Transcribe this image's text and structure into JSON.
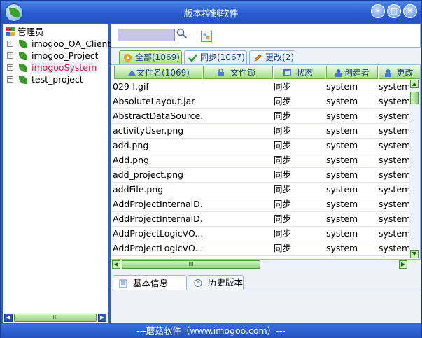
{
  "window": {
    "title": "版本控制软件",
    "footer": "---蘑菇软件（www.imogoo.com）---"
  },
  "tree": {
    "root": "管理员",
    "items": [
      {
        "label": "imogoo_OA_Client",
        "selected": false
      },
      {
        "label": "imogoo_Project",
        "selected": false
      },
      {
        "label": "imogooSystem",
        "selected": true
      },
      {
        "label": "test_project",
        "selected": false
      }
    ]
  },
  "search": {
    "value": "",
    "placeholder": ""
  },
  "tabs": [
    {
      "label": "全部(1069)",
      "icon": "asterisk-icon"
    },
    {
      "label": "同步(1067)",
      "icon": "checkmark-icon"
    },
    {
      "label": "更改(2)",
      "icon": "pencil-icon"
    }
  ],
  "columns": [
    "文件名(1069)",
    "文件锁",
    "状态",
    "创建者",
    "更改"
  ],
  "rows": [
    [
      "029-I.gif",
      "",
      "同步",
      "system",
      "system"
    ],
    [
      "AbsoluteLayout.jar",
      "",
      "同步",
      "system",
      "system"
    ],
    [
      "AbstractDataSource....",
      "",
      "同步",
      "system",
      "system"
    ],
    [
      "activityUser.png",
      "",
      "同步",
      "system",
      "system"
    ],
    [
      "add.png",
      "",
      "同步",
      "system",
      "system"
    ],
    [
      "Add.png",
      "",
      "同步",
      "system",
      "system"
    ],
    [
      "add_project.png",
      "",
      "同步",
      "system",
      "system"
    ],
    [
      "addFile.png",
      "",
      "同步",
      "system",
      "system"
    ],
    [
      "AddProjectInternalD...",
      "",
      "同步",
      "system",
      "system"
    ],
    [
      "AddProjectInternalD...",
      "",
      "同步",
      "system",
      "system"
    ],
    [
      "AddProjectLogicVO....",
      "",
      "同步",
      "system",
      "system"
    ],
    [
      "AddProjectLogicVO....",
      "",
      "同步",
      "system",
      "system"
    ]
  ],
  "bottom_tabs": [
    "基本信息",
    "历史版本"
  ],
  "scroll": {
    "thumb_glyph": "III"
  },
  "colors": {
    "accent": "#2a5cd0",
    "selected_text": "#e0203a",
    "header_green": "#9fdc86"
  }
}
